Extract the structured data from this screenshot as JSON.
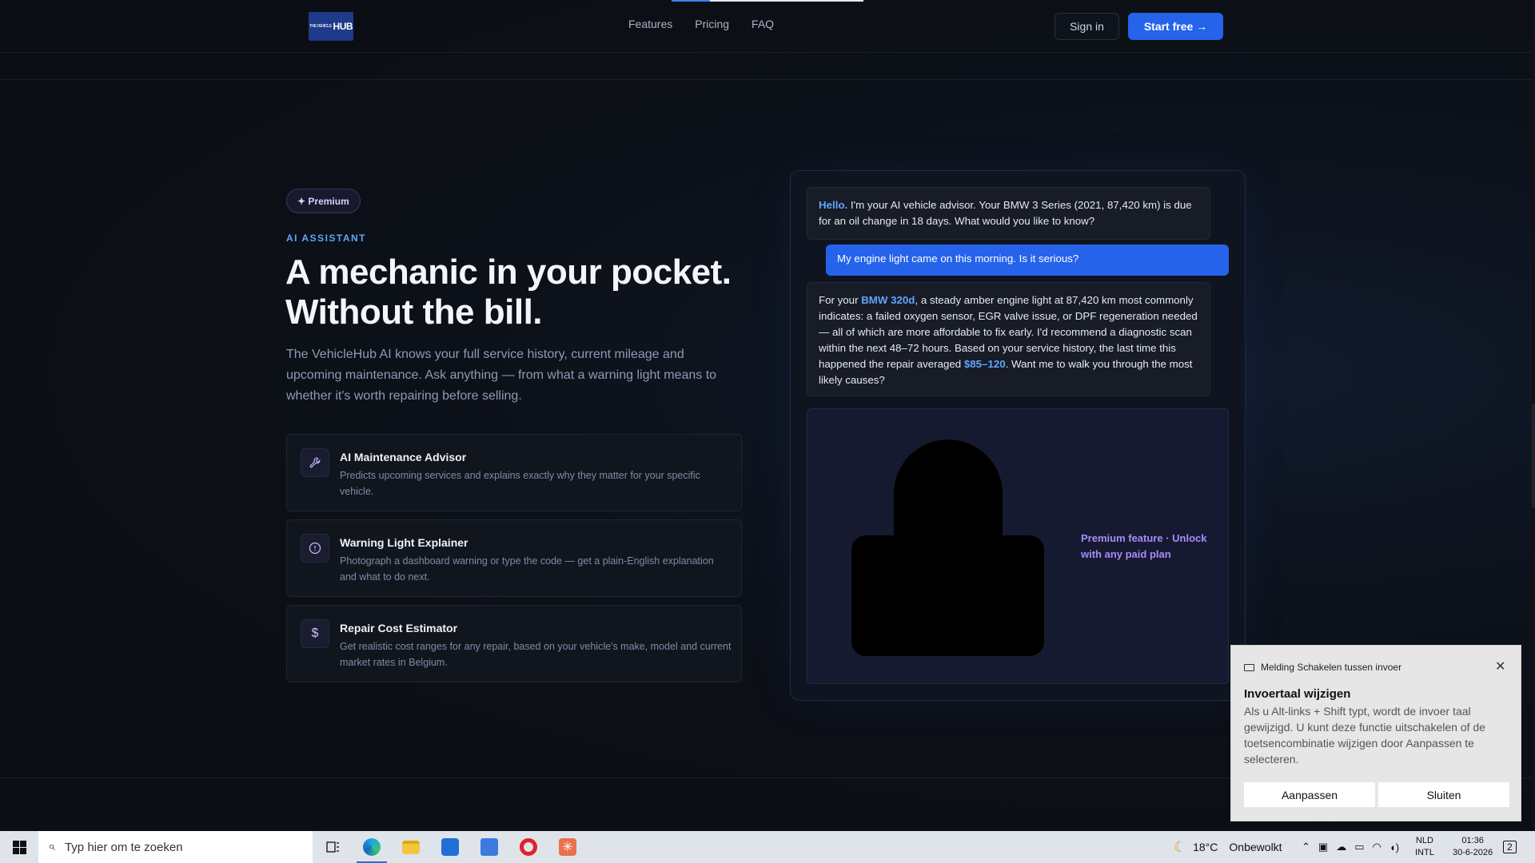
{
  "nav": {
    "logo_text": "HUB",
    "logo_small": "THE VEHICLE",
    "links": [
      "Features",
      "Pricing",
      "FAQ"
    ],
    "sign_in": "Sign in",
    "start_free": "Start free →"
  },
  "hero": {
    "badge": "✦ Premium",
    "eyebrow": "AI ASSISTANT",
    "headline_line1": "A mechanic in your pocket.",
    "headline_line2": "Without the bill.",
    "lede": "The VehicleHub AI knows your full service history, current mileage and upcoming maintenance. Ask anything — from what a warning light means to whether it's worth repairing before selling."
  },
  "features": [
    {
      "icon": "wrench-icon",
      "title": "AI Maintenance Advisor",
      "desc": "Predicts upcoming services and explains exactly why they matter for your specific vehicle."
    },
    {
      "icon": "alert-circle-icon",
      "title": "Warning Light Explainer",
      "desc": "Photograph a dashboard warning or type the code — get a plain-English explanation and what to do next."
    },
    {
      "icon": "dollar-icon",
      "title": "Repair Cost Estimator",
      "desc": "Get realistic cost ranges for any repair, based on your vehicle's make, model and current market rates in Belgium."
    }
  ],
  "chat": {
    "msg1_hl": "Hello.",
    "msg1_rest": " I'm your AI vehicle advisor. Your BMW 3 Series (2021, 87,420 km) is due for an oil change in 18 days. What would you like to know?",
    "user_msg": "My engine light came on this morning. Is it serious?",
    "msg2_a": "For your ",
    "msg2_hl1": "BMW 320d",
    "msg2_b": ", a steady amber engine light at 87,420 km most commonly indicates: a failed oxygen sensor, EGR valve issue, or DPF regeneration needed — all of which are more affordable to fix early. I'd recommend a diagnostic scan within the next 48–72 hours. Based on your service history, the last time this happened the repair averaged ",
    "msg2_hl2": "$85–120",
    "msg2_c": ". Want me to walk you through the most likely causes?",
    "locked_text": "Premium feature · Unlock with any paid plan"
  },
  "toast": {
    "header": "Melding Schakelen tussen invoer",
    "close": "✕",
    "title": "Invoertaal wijzigen",
    "body": "Als u Alt-links + Shift typt, wordt de invoer taal gewijzigd. U kunt deze functie uitschakelen of de toetsencombinatie wijzigen door Aanpassen te selecteren.",
    "btn_customize": "Aanpassen",
    "btn_close": "Sluiten"
  },
  "taskbar": {
    "search_placeholder": "Typ hier om te zoeken",
    "weather_temp": "18°C",
    "weather_desc": "Onbewolkt",
    "lang_1": "NLD",
    "lang_2": "INTL",
    "time": "01:36",
    "date": "30-6-2026",
    "notifications": "2"
  },
  "colors": {
    "accent": "#2563eb",
    "highlight": "#60a5fa",
    "premium": "#a78bfa"
  }
}
